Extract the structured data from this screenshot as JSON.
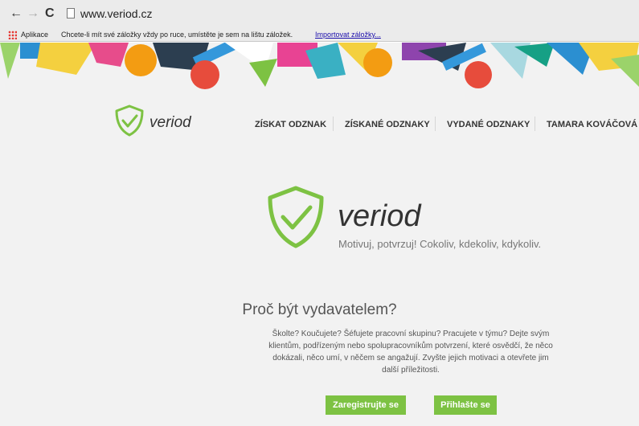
{
  "browser": {
    "url": "www.veriod.cz",
    "bookmarks": {
      "apps_label": "Aplikace",
      "message": "Chcete-li mít své záložky vždy po ruce, umístěte je sem na lištu záložek.",
      "import_link": "Importovat záložky..."
    }
  },
  "header": {
    "logo_text": "veriod",
    "nav": [
      "ZÍSKAT ODZNAK",
      "ZÍSKANÉ ODZNAKY",
      "VYDANÉ ODZNAKY",
      "TAMARA KOVÁČOVÁ"
    ]
  },
  "hero": {
    "logo_text": "veriod",
    "tagline": "Motivuj, potvrzuj! Cokoliv, kdekoliv, kdykoliv."
  },
  "why": {
    "title": "Proč být vydavatelem?",
    "text": "Školte? Koučujete? Šéfujete pracovní skupinu? Pracujete v týmu? Dejte svým klientům, podřízeným nebo spolupracovníkům potvrzení, které osvědčí, že něco dokázali, něco umí, v něčem se angažují. Zvyšte jejich motivaci a otevřete jim další příležitosti."
  },
  "buttons": {
    "register": "Zaregistrujte se",
    "login": "Přihlašte se"
  },
  "colors": {
    "brand_green": "#7dc243",
    "page_bg": "#f2f2f2"
  },
  "icons": [
    "back-arrow-icon",
    "forward-arrow-icon",
    "reload-icon",
    "page-icon",
    "apps-icon",
    "shield-check-icon"
  ]
}
